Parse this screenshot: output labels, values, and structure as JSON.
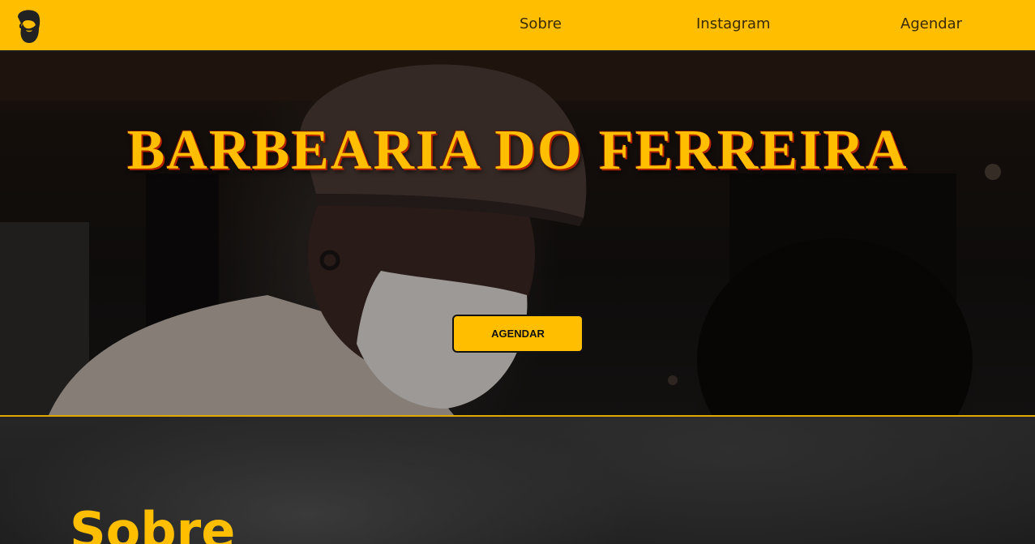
{
  "nav": {
    "logo_icon": "bearded-man-logo-icon",
    "links": [
      {
        "label": "Sobre"
      },
      {
        "label": "Instagram"
      },
      {
        "label": "Agendar"
      }
    ]
  },
  "hero": {
    "title": "BARBEARIA DO FERREIRA",
    "button_label": "AGENDAR"
  },
  "about": {
    "title": "Sobre"
  },
  "colors": {
    "accent": "#ffbe00",
    "title_shadow": "#b02200",
    "dark": "#1b1b1b"
  }
}
